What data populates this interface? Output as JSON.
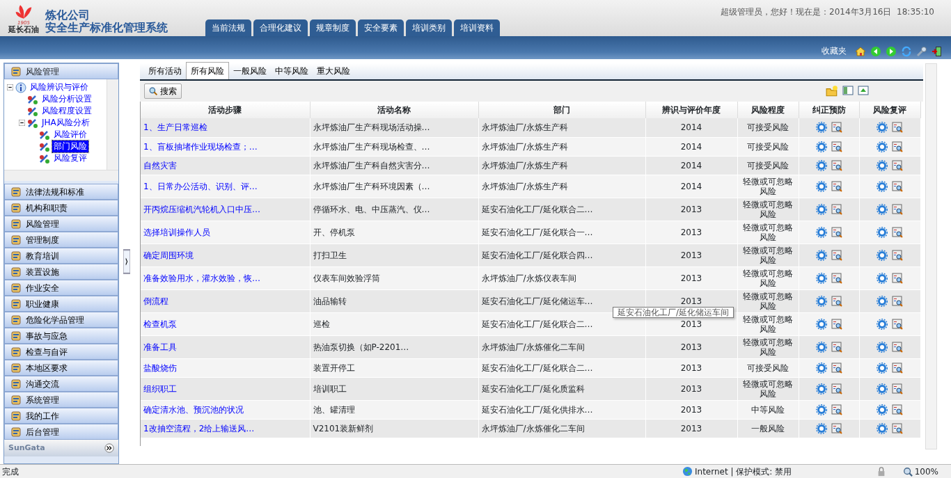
{
  "header": {
    "logo_text": "延长石油",
    "logo_year": "1905",
    "company": "炼化公司",
    "system": "安全生产标准化管理系统",
    "greeting": "超级管理员，您好！现在是：2014年3月16日  18:35:10",
    "nav_tabs": [
      {
        "label": "当前法规"
      },
      {
        "label": "合理化建议"
      },
      {
        "label": "规章制度"
      },
      {
        "label": "安全要素"
      },
      {
        "label": "培训类别"
      },
      {
        "label": "培训资料"
      }
    ]
  },
  "toolbar": {
    "favorites": "收藏夹"
  },
  "sidebar": {
    "panel_title": "风险管理",
    "tree": [
      {
        "label": "风险辨识与评价",
        "expanded": true,
        "selected": false,
        "children": [
          {
            "label": "风险分析设置",
            "selected": false
          },
          {
            "label": "风险程度设置",
            "selected": false
          },
          {
            "label": "JHA风险分析",
            "expanded": true,
            "selected": false,
            "children": [
              {
                "label": "风险评价",
                "selected": false
              },
              {
                "label": "部门风险",
                "selected": true
              },
              {
                "label": "风险复评",
                "selected": false
              }
            ]
          }
        ]
      }
    ],
    "menu": [
      "法律法规和标准",
      "机构和职责",
      "风险管理",
      "管理制度",
      "教育培训",
      "装置设施",
      "作业安全",
      "职业健康",
      "危险化学品管理",
      "事故与应急",
      "检查与自评",
      "本地区要求",
      "沟通交流",
      "系统管理",
      "我的工作",
      "后台管理"
    ],
    "brand": "SunGata"
  },
  "content": {
    "tabs": [
      {
        "label": "所有活动",
        "selected": false
      },
      {
        "label": "所有风险",
        "selected": true
      },
      {
        "label": "一般风险",
        "selected": false
      },
      {
        "label": "中等风险",
        "selected": false
      },
      {
        "label": "重大风险",
        "selected": false
      }
    ],
    "search_button": "搜索",
    "table": {
      "columns": [
        "活动步骤",
        "活动名称",
        "部门",
        "辨识与评价年度",
        "风险程度",
        "纠正预防",
        "风险复评"
      ],
      "rows": [
        {
          "step": "1、生产日常巡检",
          "name": "永坪炼油厂生产科现场活动操…",
          "dept": "永坪炼油厂/永炼生产科",
          "year": "2014",
          "level": "可接受风险"
        },
        {
          "step": "1、盲板抽堵作业现场检查；…",
          "name": "永坪炼油厂生产科现场检查、…",
          "dept": "永坪炼油厂/永炼生产科",
          "year": "2014",
          "level": "可接受风险"
        },
        {
          "step": "自然灾害",
          "name": "永坪炼油厂生产科自然灾害分…",
          "dept": "永坪炼油厂/永炼生产科",
          "year": "2014",
          "level": "可接受风险"
        },
        {
          "step": "1、日常办公活动、识别、评…",
          "name": "永坪炼油厂生产科环境因素（…",
          "dept": "永坪炼油厂/永炼生产科",
          "year": "2014",
          "level": "轻微或可忽略风险"
        },
        {
          "step": "开丙烷压缩机汽轮机入口中压…",
          "name": "停循环水、电、中压蒸汽、仪…",
          "dept": "延安石油化工厂/延化联合二…",
          "year": "2013",
          "level": "轻微或可忽略风险"
        },
        {
          "step": "选择培训操作人员",
          "name": "开、停机泵",
          "dept": "延安石油化工厂/延化联合一…",
          "year": "2013",
          "level": "轻微或可忽略风险"
        },
        {
          "step": "确定周围环境",
          "name": "打扫卫生",
          "dept": "延安石油化工厂/延化联合四…",
          "year": "2013",
          "level": "轻微或可忽略风险"
        },
        {
          "step": "准备效验用水，灌水效验，恢…",
          "name": "仪表车间效验浮筒",
          "dept": "永坪炼油厂/永炼仪表车间",
          "year": "2013",
          "level": "轻微或可忽略风险"
        },
        {
          "step": "倒流程",
          "name": "油品输转",
          "dept": "延安石油化工厂/延化储运车…",
          "year": "2013",
          "level": "轻微或可忽略风险"
        },
        {
          "step": "检查机泵",
          "name": "巡检",
          "dept": "延安石油化工厂/延化联合二…",
          "year": "2013",
          "level": "轻微或可忽略风险"
        },
        {
          "step": "准备工具",
          "name": "热油泵切换（如P-2201…",
          "dept": "永坪炼油厂/永炼催化二车间",
          "year": "2013",
          "level": "轻微或可忽略风险"
        },
        {
          "step": "盐酸烧伤",
          "name": "装置开停工",
          "dept": "延安石油化工厂/延化联合二…",
          "year": "2013",
          "level": "可接受风险"
        },
        {
          "step": "组织职工",
          "name": "培训职工",
          "dept": "延安石油化工厂/延化质监科",
          "year": "2013",
          "level": "轻微或可忽略风险"
        },
        {
          "step": "确定清水池、预沉池的状况",
          "name": "池、罐清理",
          "dept": "延安石油化工厂/延化供排水…",
          "year": "2013",
          "level": "中等风险"
        },
        {
          "step": "1改抽空流程，2给上输送风…",
          "name": "V2101装新鲜剂",
          "dept": "永坪炼油厂/永炼催化二车间",
          "year": "2013",
          "level": "一般风险"
        }
      ]
    },
    "tooltip": "延安石油化工厂/延化储运车间"
  },
  "status_bar": {
    "status": "完成",
    "zone": "Internet | 保护模式: 禁用",
    "zoom": "100%"
  }
}
